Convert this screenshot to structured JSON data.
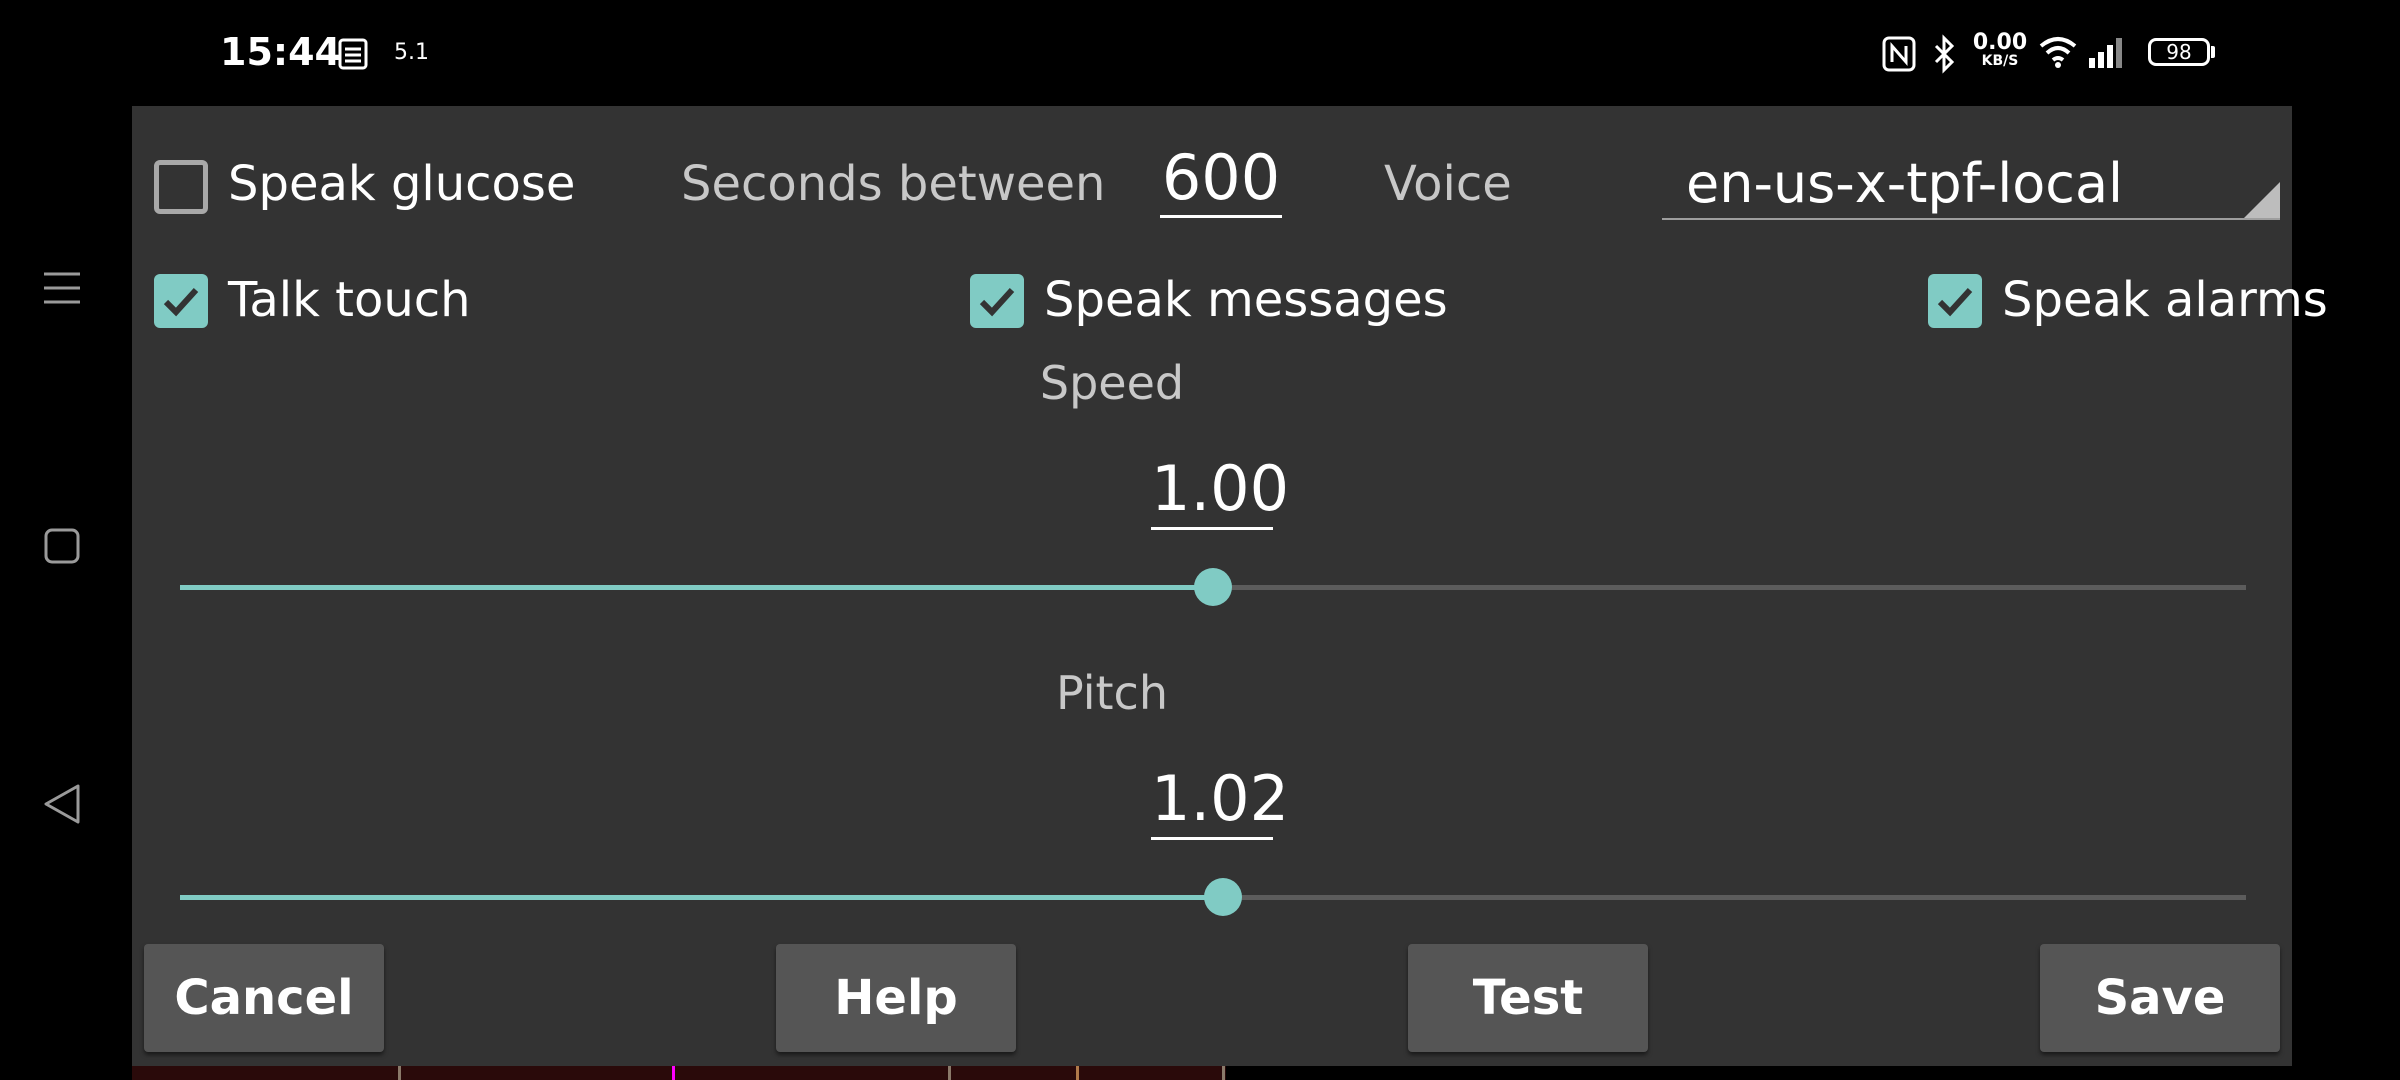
{
  "status_bar": {
    "time": "15:44",
    "notif_value": "5.1",
    "net_speed": "0.00",
    "net_unit": "KB/S",
    "battery": "98",
    "icons": [
      "notification-icon",
      "nfc-icon",
      "bluetooth-icon",
      "wifi-icon",
      "signal-icon",
      "battery-icon"
    ]
  },
  "nav_bar": {
    "icons": [
      "menu-icon",
      "home-icon",
      "back-icon"
    ]
  },
  "dialog": {
    "speak_glucose": {
      "label": "Speak glucose",
      "checked": false
    },
    "seconds_between": {
      "label": "Seconds between",
      "value": "600"
    },
    "voice": {
      "label": "Voice",
      "value": "en-us-x-tpf-local"
    },
    "talk_touch": {
      "label": "Talk touch",
      "checked": true
    },
    "speak_messages": {
      "label": "Speak messages",
      "checked": true
    },
    "speak_alarms": {
      "label": "Speak alarms",
      "checked": true
    },
    "speed": {
      "label": "Speed",
      "value": "1.00",
      "fraction": 0.5
    },
    "pitch": {
      "label": "Pitch",
      "value": "1.02",
      "fraction": 0.505
    },
    "buttons": {
      "cancel": "Cancel",
      "help": "Help",
      "test": "Test",
      "save": "Save"
    }
  },
  "colors": {
    "accent": "#80cbc4",
    "dialog_bg": "#333333",
    "button_bg": "#555555"
  }
}
